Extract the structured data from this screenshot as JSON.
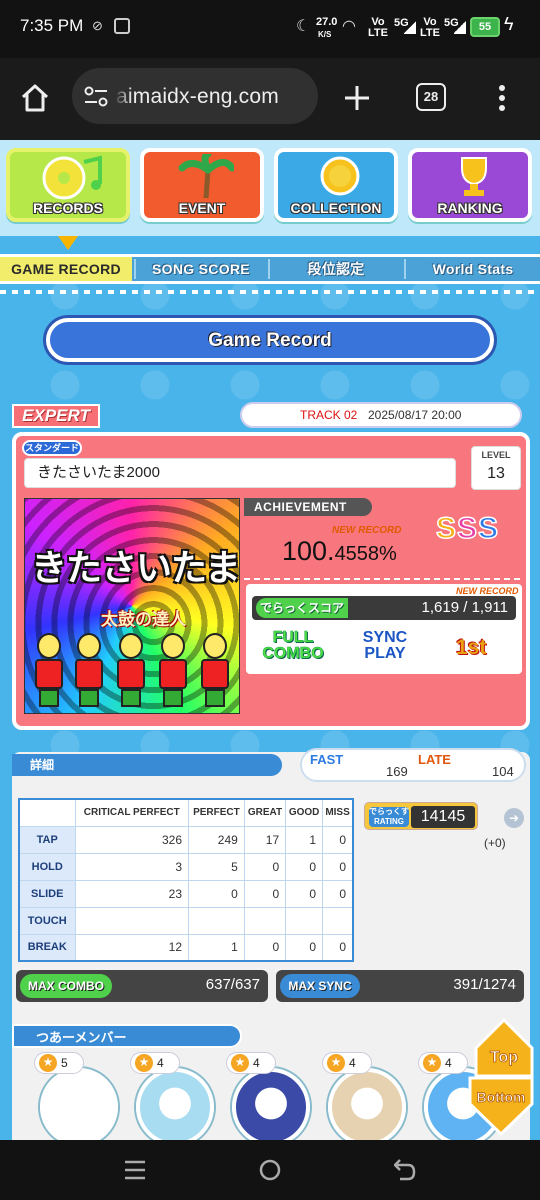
{
  "status": {
    "time": "7:35 PM",
    "net_speed_value": "27.0",
    "net_speed_unit": "K/S",
    "sim1": "Vo\nLTE",
    "sim2": "Vo\nLTE",
    "net1": "5G",
    "net2": "5G",
    "battery": "55"
  },
  "browser": {
    "url": "aimaidx-eng.com",
    "tab_count": "28"
  },
  "nav": {
    "items": [
      {
        "label": "RECORDS",
        "color": "#b6e84a"
      },
      {
        "label": "EVENT",
        "color": "#f25b2e"
      },
      {
        "label": "COLLECTION",
        "color": "#3aa9e6"
      },
      {
        "label": "RANKING",
        "color": "#9a49d6"
      }
    ]
  },
  "subnav": {
    "items": [
      "GAME RECORD",
      "SONG SCORE",
      "段位認定",
      "World Stats"
    ]
  },
  "page_title": "Game Record",
  "record": {
    "difficulty": "EXPERT",
    "track": "TRACK 02",
    "date": "2025/08/17 20:00",
    "song": "きたさいたま2000",
    "level_label": "LEVEL",
    "level": "13",
    "type_tag": "スタンダード",
    "jacket_title": "きたさいたま2000",
    "jacket_sub": "太鼓の達人",
    "achievement_label": "ACHIEVEMENT",
    "new_record": "NEW RECORD",
    "achievement_int": "100.",
    "achievement_dec": "4558%",
    "rank": [
      "S",
      "S",
      "S"
    ],
    "dx_label": "でらっくスコア",
    "dx_new_record": "NEW RECORD",
    "dx_score": "1,619 / 1,911",
    "fc_top": "FULL",
    "fc_bottom": "COMBO",
    "sync_top": "SYNC",
    "sync_bottom": "PLAY",
    "place": "1st"
  },
  "detail": {
    "header": "詳細",
    "fast_label": "FAST",
    "fast": "169",
    "late_label": "LATE",
    "late": "104",
    "columns": [
      "",
      "CRITICAL PERFECT",
      "PERFECT",
      "GREAT",
      "GOOD",
      "MISS"
    ],
    "rows": [
      {
        "label": "TAP",
        "values": [
          "326",
          "249",
          "17",
          "1",
          "0"
        ]
      },
      {
        "label": "HOLD",
        "values": [
          "3",
          "5",
          "0",
          "0",
          "0"
        ]
      },
      {
        "label": "SLIDE",
        "values": [
          "23",
          "0",
          "0",
          "0",
          "0"
        ]
      },
      {
        "label": "TOUCH",
        "values": [
          "",
          "",
          "",
          "",
          ""
        ]
      },
      {
        "label": "BREAK",
        "values": [
          "12",
          "1",
          "0",
          "0",
          "0"
        ]
      }
    ],
    "rating_label": "でらっくす RATING",
    "rating": "14145",
    "rating_delta": "(+0)",
    "max_combo_label": "MAX COMBO",
    "max_combo": "637/637",
    "max_sync_label": "MAX SYNC",
    "max_sync": "391/1274",
    "members_header": "つあーメンバー",
    "members": [
      {
        "stars": "5",
        "color": "#ffffff"
      },
      {
        "stars": "4",
        "color": "#a8dcf0"
      },
      {
        "stars": "4",
        "color": "#3a4aa6"
      },
      {
        "stars": "4",
        "color": "#e6d2b0"
      },
      {
        "stars": "4",
        "color": "#5fb3f2"
      }
    ],
    "top_label": "Top",
    "bottom_label": "Bottom"
  }
}
